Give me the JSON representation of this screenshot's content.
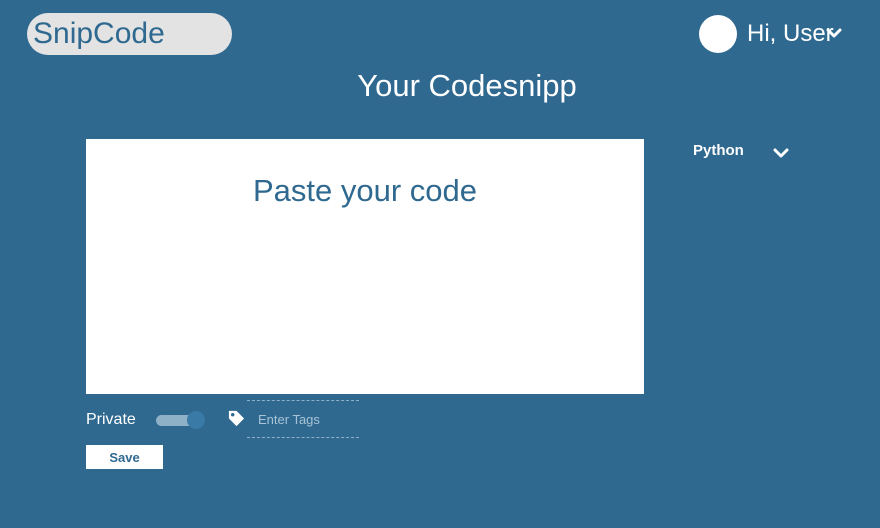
{
  "header": {
    "logo_text": "SnipCode",
    "greeting": "Hi, User",
    "user_menu_icon": "chevron-down-icon"
  },
  "main": {
    "page_title": "Your Codesnipp",
    "editor_placeholder": "Paste your code",
    "language": {
      "selected": "Python",
      "icon": "chevron-down-icon"
    },
    "private_label": "Private",
    "private_enabled": true,
    "tags_placeholder": "Enter Tags",
    "tag_icon": "tag-icon",
    "save_label": "Save"
  },
  "colors": {
    "background": "#2f6990",
    "logo_pill": "#e3e3e3",
    "editor_bg": "#ffffff",
    "text": "#ffffff"
  }
}
